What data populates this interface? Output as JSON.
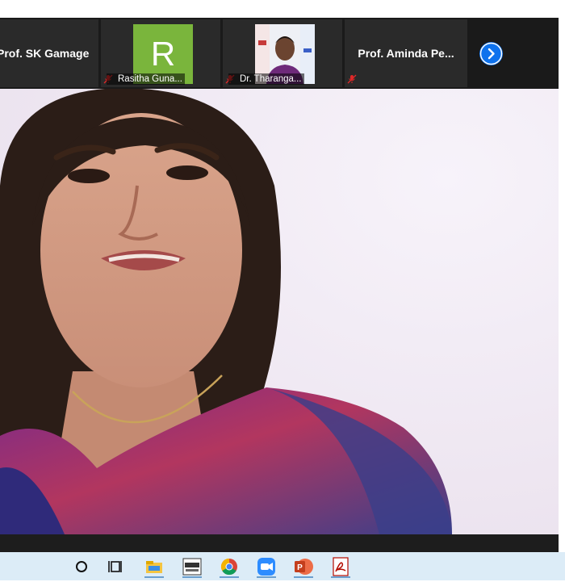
{
  "participants": [
    {
      "name": "Prof. SK Gamage",
      "display": "name"
    },
    {
      "name": "Rasitha Guna...",
      "display": "avatar",
      "avatar_letter": "R",
      "avatar_color": "#7ab53c",
      "muted": true
    },
    {
      "name": "Dr. Tharanga...",
      "display": "video",
      "muted": true
    },
    {
      "name": "Prof. Aminda Pe...",
      "display": "name",
      "muted": true
    }
  ],
  "next_button_icon": "chevron-right-icon",
  "taskbar": {
    "items": [
      "cortana-icon",
      "task-view-icon",
      "file-explorer-icon",
      "app-icon",
      "chrome-icon",
      "zoom-icon",
      "powerpoint-icon",
      "acrobat-icon"
    ]
  },
  "colors": {
    "strip_bg": "#1a1a1a",
    "accent_blue": "#0e72ed",
    "mute_red": "#e02828",
    "taskbar_bg": "#dcecf7"
  }
}
